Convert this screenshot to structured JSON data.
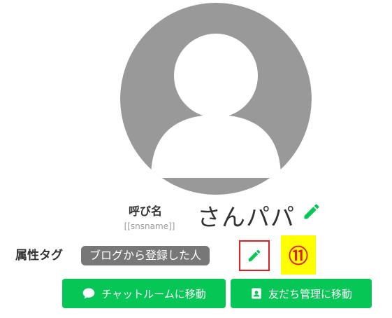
{
  "profile": {
    "nickname_label": "呼び名",
    "nickname_variable": "[[snsname]]",
    "nickname_value": "さんパパ"
  },
  "tags": {
    "label": "属性タグ",
    "items": [
      "ブログから登録した人"
    ]
  },
  "annotation": {
    "marker": "⑪"
  },
  "actions": {
    "chat_room": "チャットルームに移動",
    "friend_management": "友だち管理に移動"
  },
  "colors": {
    "brand_green": "#06c755",
    "avatar_gray": "#999999",
    "tag_gray": "#777777",
    "highlight_red": "#e02020",
    "highlight_yellow": "#ffff00"
  },
  "icons": {
    "avatar": "user-placeholder-icon",
    "edit": "pencil-icon",
    "chat": "speech-bubble-icon",
    "friends": "contact-card-icon"
  }
}
